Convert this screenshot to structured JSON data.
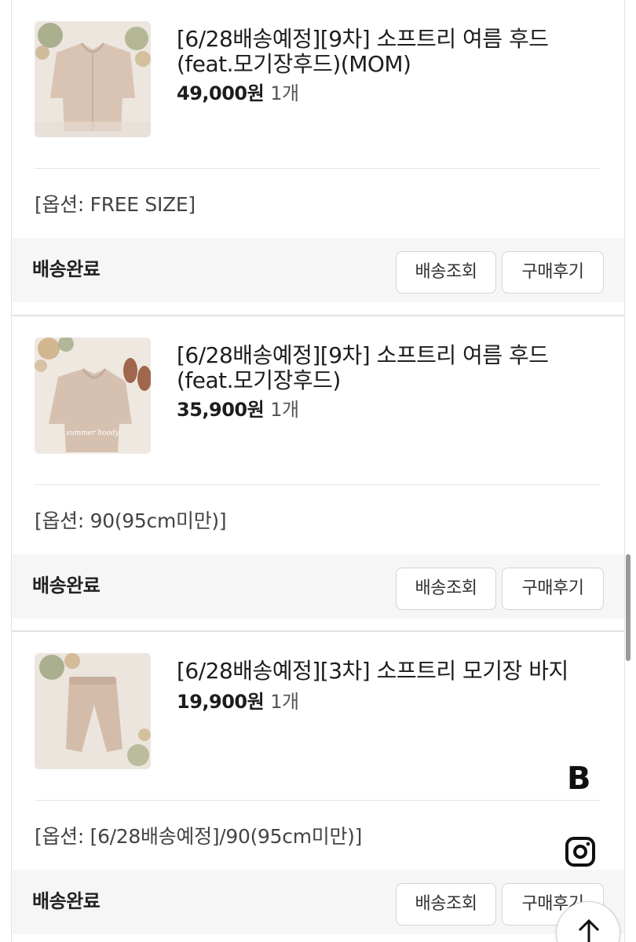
{
  "orders": [
    {
      "title_line1": "[6/28배송예정][9차] 소프트리 여름 후드",
      "title_line2": "(feat.모기장후드)(MOM)",
      "price": "49,000원",
      "qty": "1개",
      "option": "[옵션: FREE SIZE]",
      "status": "배송완료",
      "track_button": "배송조회",
      "review_button": "구매후기",
      "thumbnail_icon": "hoodie-product-image"
    },
    {
      "title_line1": "[6/28배송예정][9차] 소프트리 여름 후드",
      "title_line2": "(feat.모기장후드)",
      "price": "35,900원",
      "qty": "1개",
      "option": "[옵션: 90(95cm미만)]",
      "status": "배송완료",
      "track_button": "배송조회",
      "review_button": "구매후기",
      "thumbnail_icon": "kids-hoodie-product-image"
    },
    {
      "title_line1": "[6/28배송예정][3차] 소프트리 모기장 바지",
      "title_line2": "",
      "price": "19,900원",
      "qty": "1개",
      "option": "[옵션: [6/28배송예정]/90(95cm미만)]",
      "status": "배송완료",
      "track_button": "배송조회",
      "review_button": "구매후기",
      "thumbnail_icon": "pants-product-image"
    }
  ],
  "floating": {
    "brand_letter": "B",
    "instagram_icon": "instagram-icon",
    "top_icon": "arrow-up-icon"
  },
  "colors": {
    "status_bar_bg": "#f6f6f6",
    "button_border": "#d5d5d5",
    "product_beige": "#d9c4b4"
  }
}
